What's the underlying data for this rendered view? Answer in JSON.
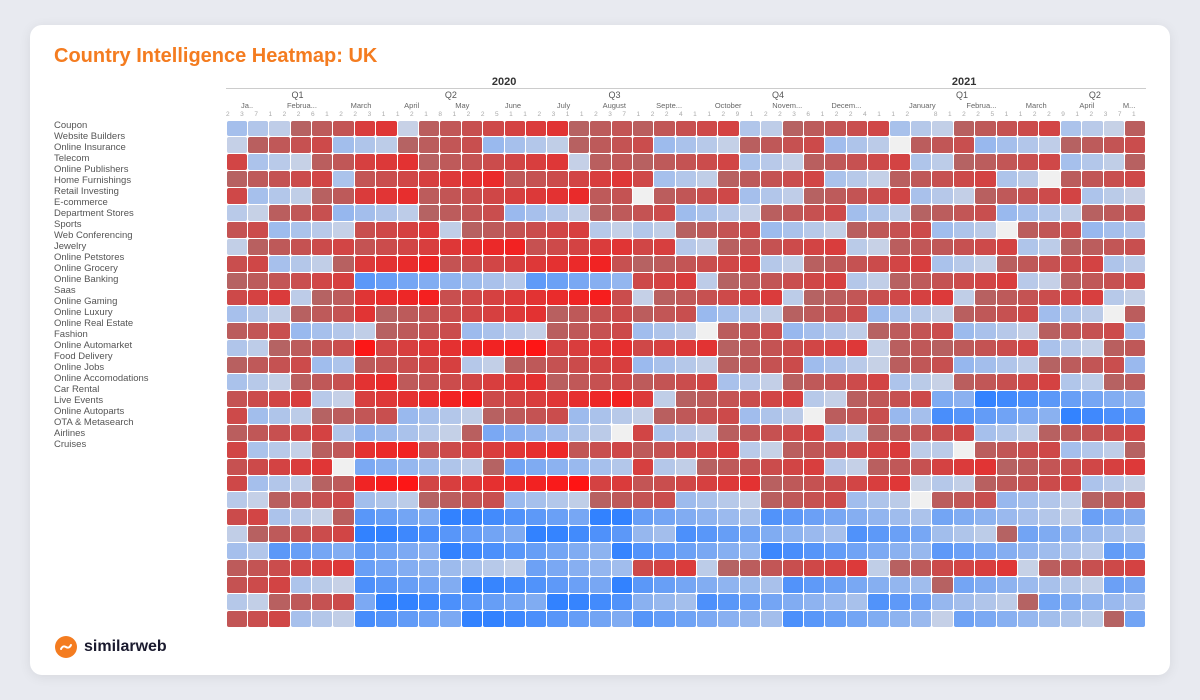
{
  "title": "Country Intelligence Heatmap: UK",
  "footer": {
    "brand": "similarweb"
  },
  "years": [
    {
      "label": "2020",
      "colSpan": 26
    },
    {
      "label": "2021",
      "colSpan": 17
    }
  ],
  "quarters_2020": [
    {
      "label": "Q1",
      "cols": 7
    },
    {
      "label": "Q2",
      "cols": 8
    },
    {
      "label": "Q3",
      "cols": 8
    },
    {
      "label": "Q4",
      "cols": 8
    }
  ],
  "quarters_2021": [
    {
      "label": "Q1",
      "cols": 8
    },
    {
      "label": "Q2",
      "cols": 5
    }
  ],
  "months": [
    "Ja..",
    "Februa...",
    "March",
    "April",
    "May",
    "June",
    "July",
    "August",
    "Septe...",
    "October",
    "Novem...",
    "Decem...",
    "January",
    "Februa...",
    "March",
    "April",
    "M..."
  ],
  "rows": [
    "Coupon",
    "Website Builders",
    "Online Insurance",
    "Telecom",
    "Online Publishers",
    "Home Furnishings",
    "Retail Investing",
    "E-commerce",
    "Department Stores",
    "Sports",
    "Web Conferencing",
    "Jewelry",
    "Online Petstores",
    "Online Grocery",
    "Online Banking",
    "Saas",
    "Online Gaming",
    "Online Luxury",
    "Online Real Estate",
    "Fashion",
    "Online Automarket",
    "Food Delivery",
    "Online Jobs",
    "Online Accomodations",
    "Car Rental",
    "Live Events",
    "Online Autoparts",
    "OTA & Metasearch",
    "Airlines",
    "Cruises"
  ],
  "colors": {
    "strong_red": "#d73027",
    "mid_red": "#e87060",
    "light_red": "#f4a58a",
    "pale_red": "#fcd9cc",
    "white": "#f7f7f7",
    "pale_blue": "#d4e6f4",
    "mid_blue": "#92c0e0",
    "strong_blue": "#3b7fc4",
    "dark_blue": "#1a4b8c",
    "accent_orange": "#f47c20"
  }
}
